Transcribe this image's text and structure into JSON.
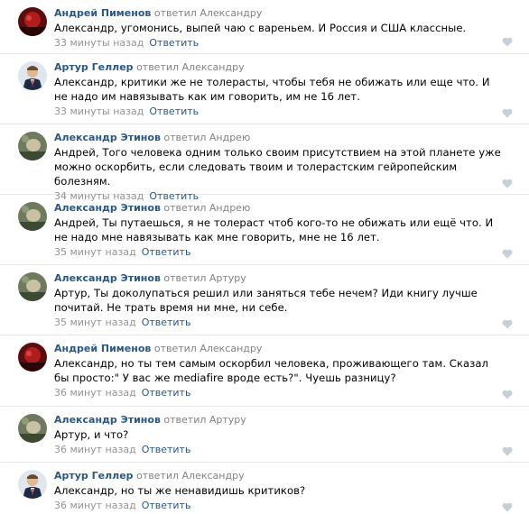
{
  "comments": [
    {
      "author": "Андрей Пименов",
      "replied": "ответил Александру",
      "text": "Александр, угомонись, выпей чаю с вареньем. И Россия и США классные.",
      "time": "33 минуты назад",
      "reply_label": "Ответить",
      "avatar_icon": "avatar-red-photo"
    },
    {
      "author": "Артур Геллер",
      "replied": "ответил Александру",
      "text": "Александр, критики же не толерасты, чтобы тебя не обижать или еще что. И не надо им навязывать как им говорить, им не 16 лет.",
      "time": "33 минуты назад",
      "reply_label": "Ответить",
      "avatar_icon": "avatar-suit-photo"
    },
    {
      "author": "Александр Этинов",
      "replied": "ответил Андрею",
      "text": "Андрей, Того человека одним только своим присутствием на этой планете уже можно оскорбить, если следовать твоим и толерастским гейропейским болезням.",
      "time": "34 минуты назад",
      "reply_label": "Ответить",
      "avatar_icon": "avatar-green-photo"
    },
    {
      "author": "Александр Этинов",
      "replied": "ответил Андрею",
      "text": "Андрей, Ты путаешься, я не толераст чтоб кого-то не обижать или ещё что. И не надо мне навязывать как мне говорить, мне не 16 лет.",
      "time": "35 минут назад",
      "reply_label": "Ответить",
      "avatar_icon": "avatar-green-photo"
    },
    {
      "author": "Александр Этинов",
      "replied": "ответил Артуру",
      "text": "Артур, Ты доколупаться решил или заняться тебе нечем? Иди книгу лучше почитай. Не трать время ни мне, ни себе.",
      "time": "35 минут назад",
      "reply_label": "Ответить",
      "avatar_icon": "avatar-green-photo"
    },
    {
      "author": "Андрей Пименов",
      "replied": "ответил Александру",
      "text": "Александр, но ты тем самым оскорбил человека, проживающего там. Сказал бы просто:\" У вас же mediafire вроде есть?\". Чуешь разницу?",
      "time": "36 минут назад",
      "reply_label": "Ответить",
      "avatar_icon": "avatar-red-photo"
    },
    {
      "author": "Александр Этинов",
      "replied": "ответил Артуру",
      "text": "Артур, и что?",
      "time": "36 минут назад",
      "reply_label": "Ответить",
      "avatar_icon": "avatar-green-photo"
    },
    {
      "author": "Артур Геллер",
      "replied": "ответил Александру",
      "text": "Александр, но ты же ненавидишь критиков?",
      "time": "36 минут назад",
      "reply_label": "Ответить",
      "avatar_icon": "avatar-suit-photo"
    }
  ],
  "colors": {
    "link": "#2a5885",
    "muted": "#828282",
    "time": "#939393",
    "like_icon": "#c5d0db",
    "divider": "#e7e8ec"
  }
}
